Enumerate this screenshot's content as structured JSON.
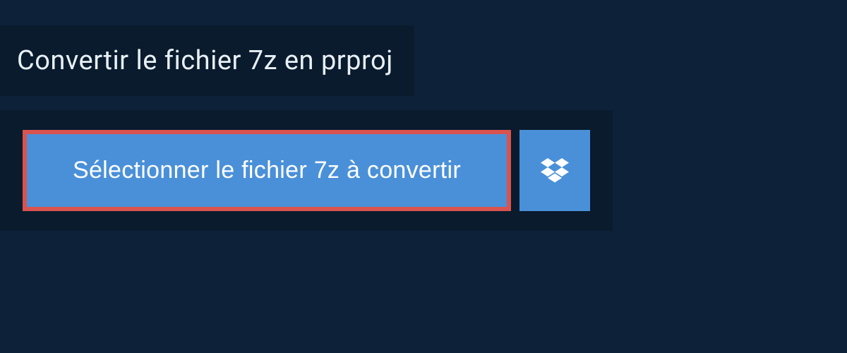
{
  "header": {
    "title": "Convertir le fichier 7z en prproj"
  },
  "upload": {
    "select_button_label": "Sélectionner le fichier 7z à convertir"
  },
  "colors": {
    "background": "#0d2238",
    "panel": "#0a1b2e",
    "button": "#4a90d9",
    "highlight_border": "#d9534f",
    "text_light": "#e8f0f5"
  }
}
